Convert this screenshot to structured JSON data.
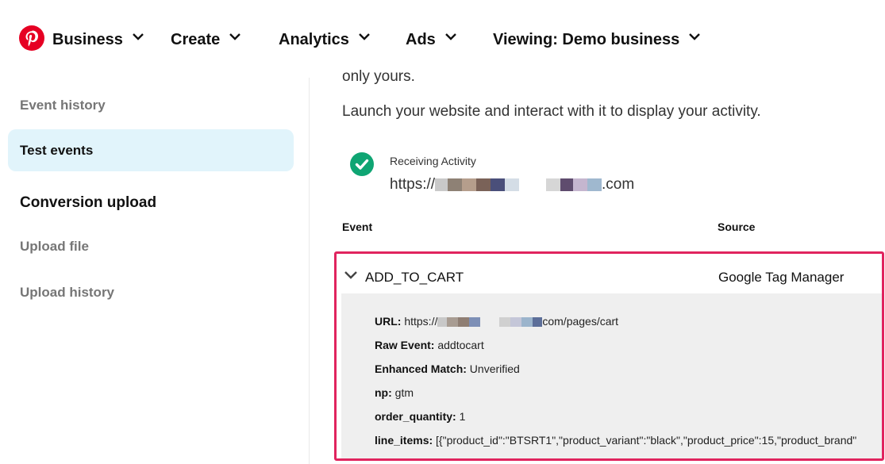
{
  "nav": {
    "items": [
      {
        "label": "Business"
      },
      {
        "label": "Create"
      },
      {
        "label": "Analytics"
      },
      {
        "label": "Ads"
      },
      {
        "label": "Viewing: Demo business"
      }
    ]
  },
  "sidebar": {
    "event_history": "Event history",
    "test_events": "Test events",
    "conversion_upload": "Conversion upload",
    "upload_file": "Upload file",
    "upload_history": "Upload history"
  },
  "main": {
    "cut_text": "only yours.",
    "intro": "Launch your website and interact with it to display your activity.",
    "status_label": "Receiving Activity",
    "status_url_prefix": "https://",
    "status_url_suffix": ".com",
    "table": {
      "col_event": "Event",
      "col_source": "Source"
    },
    "event": {
      "name": "ADD_TO_CART",
      "source": "Google Tag Manager",
      "details": {
        "url_key": "URL:",
        "url_prefix": "https://",
        "url_suffix": "com/pages/cart",
        "raw_event_key": "Raw Event:",
        "raw_event_value": "addtocart",
        "enhanced_match_key": "Enhanced Match:",
        "enhanced_match_value": "Unverified",
        "np_key": "np:",
        "np_value": "gtm",
        "order_quantity_key": "order_quantity:",
        "order_quantity_value": "1",
        "line_items_key": "line_items:",
        "line_items_value": "[{\"product_id\":\"BTSRT1\",\"product_variant\":\"black\",\"product_price\":15,\"product_brand\""
      }
    }
  },
  "colors": {
    "brand": "#e60023",
    "active_bg": "#e1f4fb",
    "success": "#0fa573",
    "highlight_border": "#e0245e"
  },
  "icons": {
    "logo": "pinterest-logo",
    "chevron": "chevron-down-icon",
    "status": "check-circle-icon"
  }
}
